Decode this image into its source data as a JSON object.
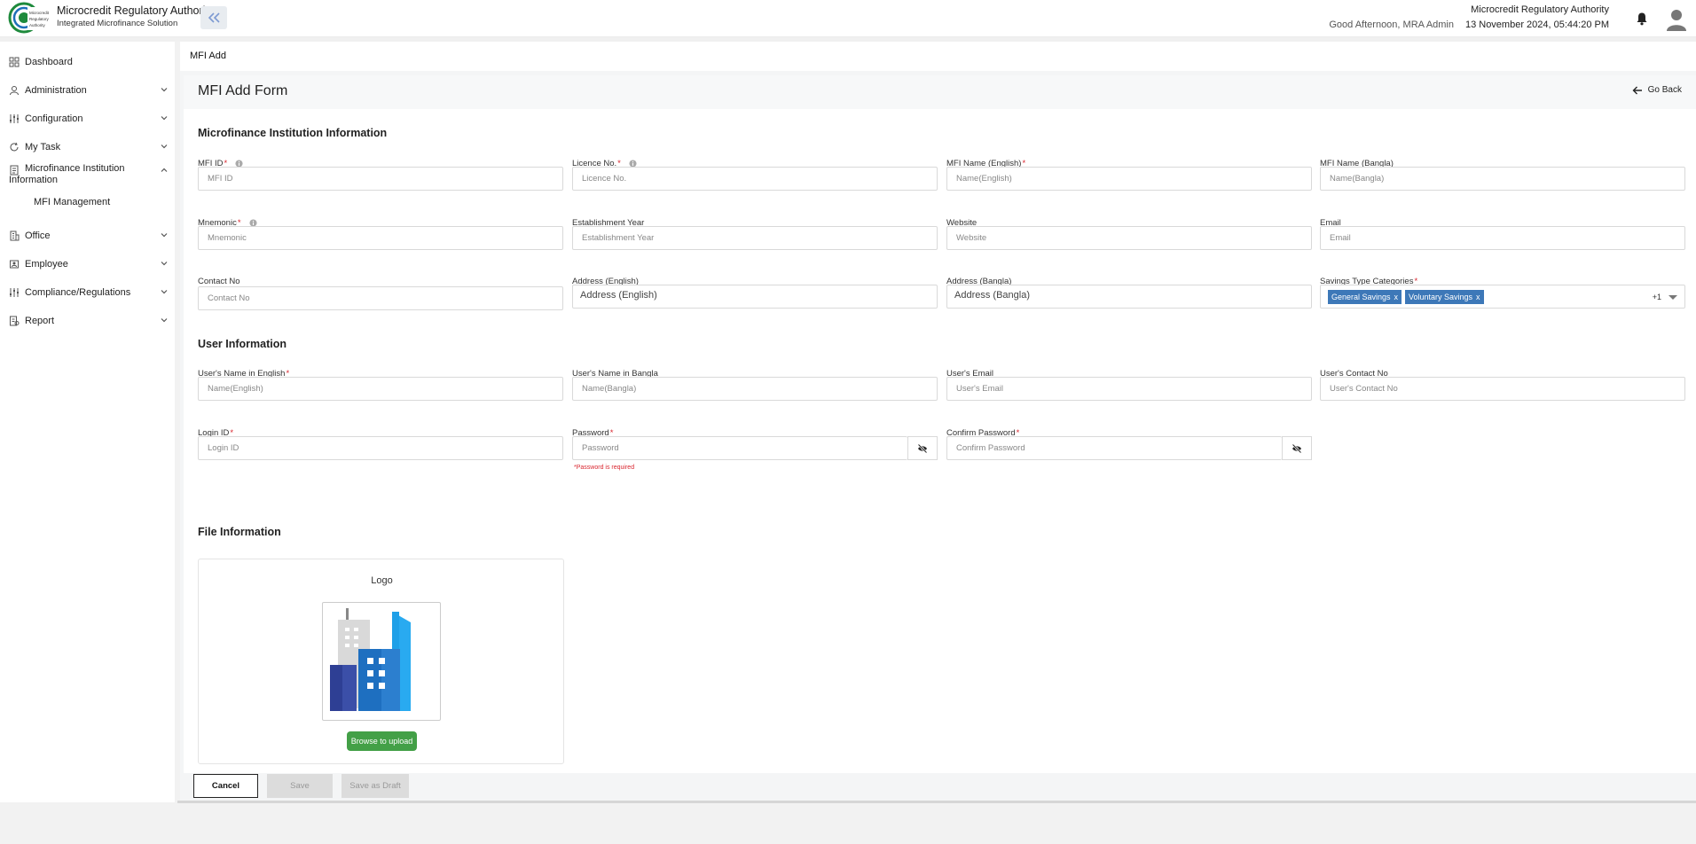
{
  "header": {
    "brand_title": "Microcredit Regulatory Authority",
    "brand_subtitle": "Integrated Microfinance Solution",
    "logo_text": "Microcredit Regulatory Authority",
    "greeting": "Good Afternoon, MRA Admin",
    "org_name": "Microcredit Regulatory Authority",
    "datetime": "13 November 2024, 05:44:20 PM"
  },
  "sidebar": {
    "items": [
      {
        "label": "Dashboard",
        "icon": "grid-icon"
      },
      {
        "label": "Administration",
        "icon": "users-icon"
      },
      {
        "label": "Configuration",
        "icon": "sliders-icon"
      },
      {
        "label": "My Task",
        "icon": "refresh-icon"
      },
      {
        "label": "Microfinance Institution Information",
        "icon": "document-icon"
      },
      {
        "label": "Office",
        "icon": "building-icon"
      },
      {
        "label": "Employee",
        "icon": "employee-icon"
      },
      {
        "label": "Compliance/Regulations",
        "icon": "sliders-icon"
      },
      {
        "label": "Report",
        "icon": "report-icon"
      }
    ],
    "sub_item": "MFI Management"
  },
  "breadcrumb": "MFI Add",
  "form": {
    "title": "MFI Add Form",
    "go_back": "Go Back",
    "section_institution": "Microfinance Institution Information",
    "section_user": "User Information",
    "section_file": "File Information",
    "fields": {
      "mfi_id": {
        "label": "MFI ID",
        "placeholder": "MFI ID"
      },
      "licence_no": {
        "label": "Licence No.",
        "placeholder": "Licence No."
      },
      "mfi_name_en": {
        "label": "MFI Name (English)",
        "placeholder": "Name(English)"
      },
      "mfi_name_bn": {
        "label": "MFI Name (Bangla)",
        "placeholder": "Name(Bangla)"
      },
      "mnemonic": {
        "label": "Mnemonic",
        "placeholder": "Mnemonic"
      },
      "establishment_year": {
        "label": "Establishment Year",
        "placeholder": "Establishment Year"
      },
      "website": {
        "label": "Website",
        "placeholder": "Website"
      },
      "email": {
        "label": "Email",
        "placeholder": "Email"
      },
      "contact_no": {
        "label": "Contact No",
        "placeholder": "Contact No"
      },
      "address_en": {
        "label": "Address (English)",
        "placeholder": "Address (English)"
      },
      "address_bn": {
        "label": "Address (Bangla)",
        "placeholder": "Address (Bangla)"
      },
      "savings_types": {
        "label": "Savings Type Categories",
        "chips": [
          "General Savings",
          "Voluntary Savings"
        ],
        "more": "+1",
        "chip_remove": "x"
      },
      "user_name_en": {
        "label": "User's Name in English",
        "placeholder": "Name(English)"
      },
      "user_name_bn": {
        "label": "User's Name in Bangla",
        "placeholder": "Name(Bangla)"
      },
      "user_email": {
        "label": "User's Email",
        "placeholder": "User's Email"
      },
      "user_contact": {
        "label": "User's Contact No",
        "placeholder": "User's Contact No"
      },
      "login_id": {
        "label": "Login ID",
        "placeholder": "Login ID"
      },
      "password": {
        "label": "Password",
        "placeholder": "Password",
        "error": "*Password is required"
      },
      "confirm_password": {
        "label": "Confirm Password",
        "placeholder": "Confirm Password"
      }
    },
    "required_mark": "*",
    "upload": {
      "title": "Logo",
      "button": "Browse to upload"
    }
  },
  "actions": {
    "cancel": "Cancel",
    "save": "Save",
    "save_draft": "Save as Draft"
  },
  "colors": {
    "accent": "#3d78b8",
    "success": "#43a047",
    "error": "#d9262f"
  }
}
